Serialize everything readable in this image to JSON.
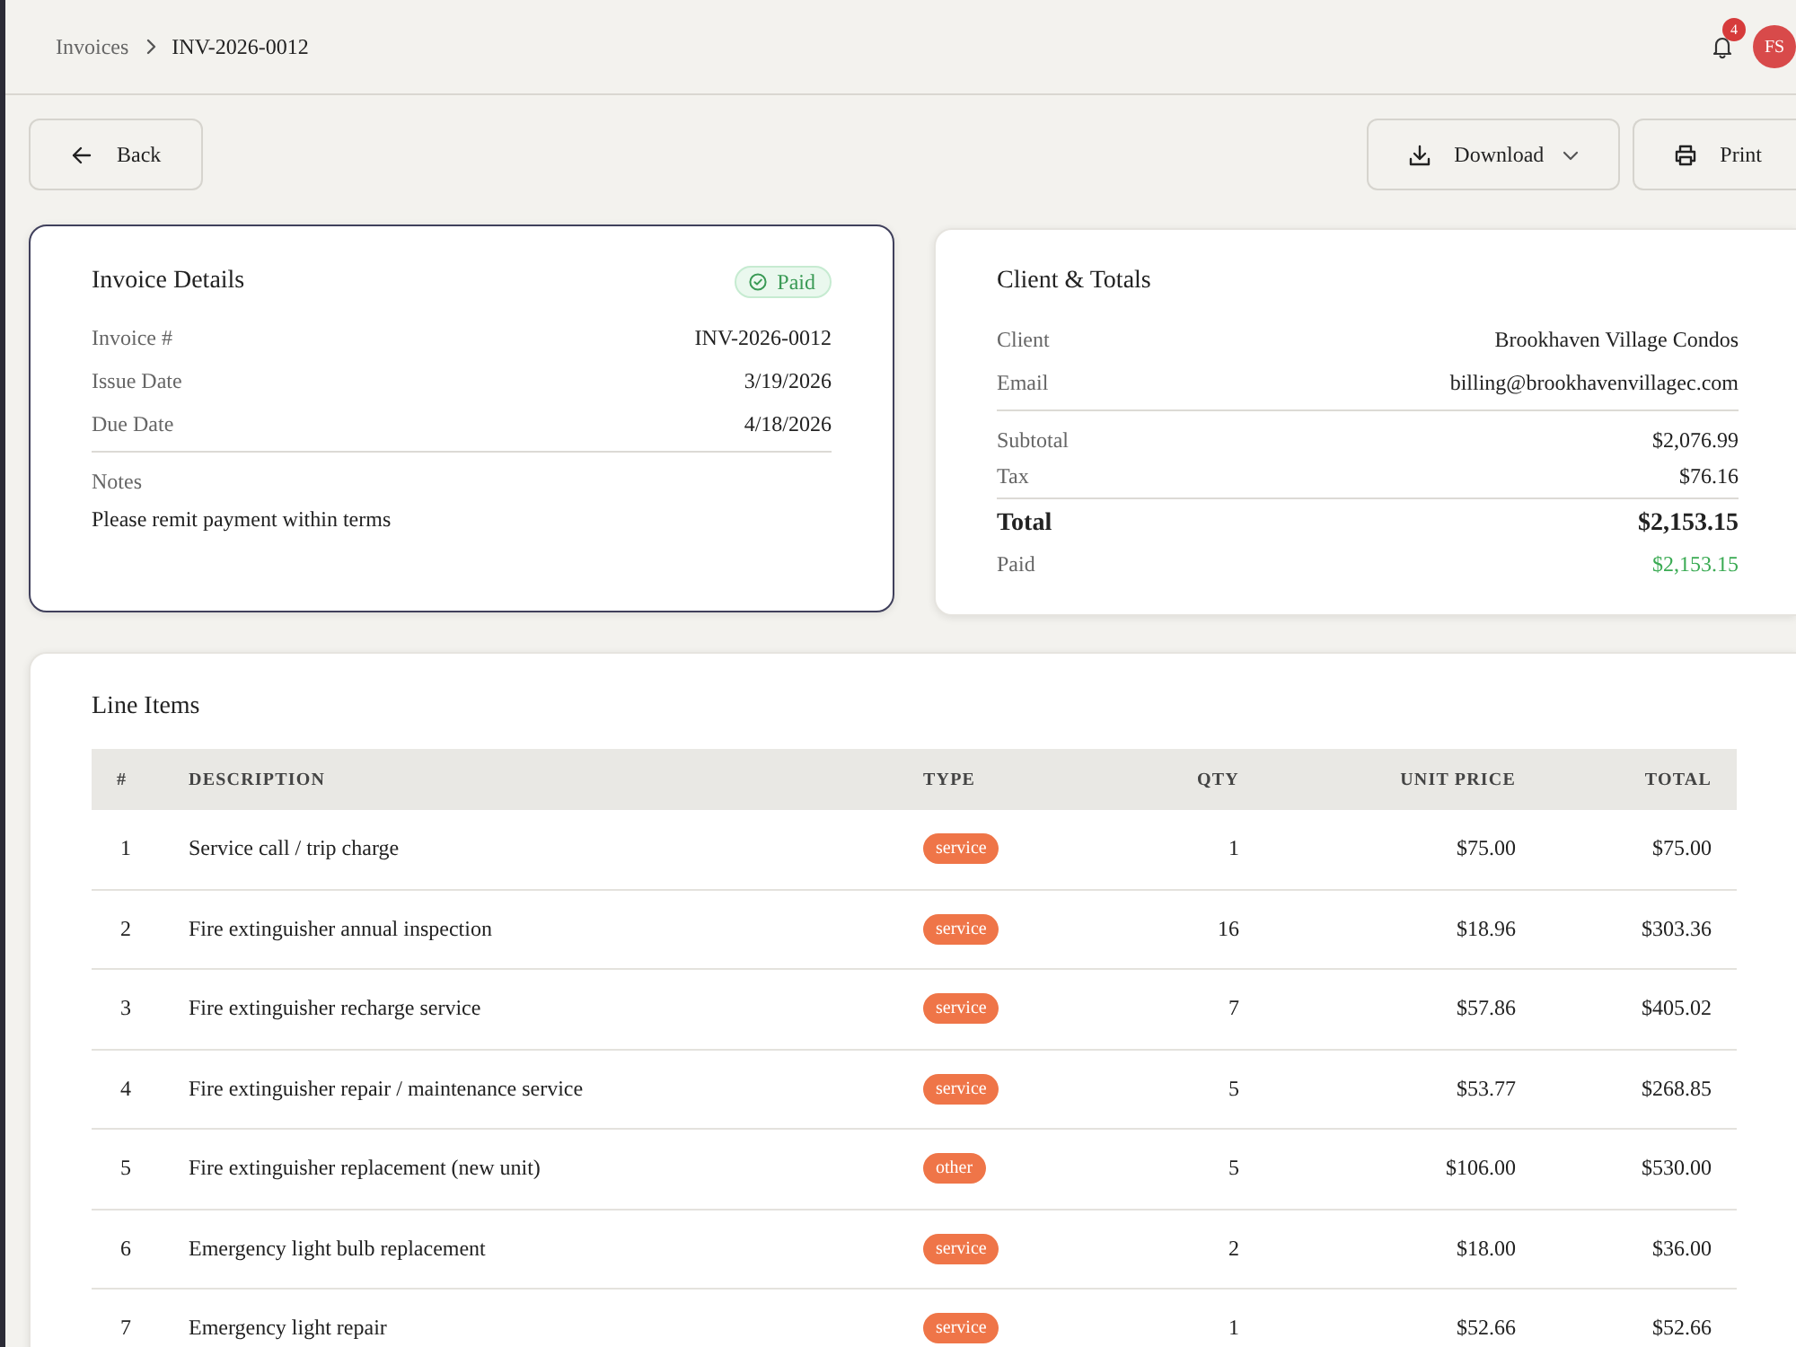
{
  "breadcrumb": [
    {
      "label": "Invoices",
      "current": false
    },
    {
      "label": "INV-2026-0012",
      "current": true
    }
  ],
  "header": {
    "notification_count": "4",
    "avatar_initials": "FS"
  },
  "toolbar": {
    "back": "Back",
    "download": "Download",
    "print": "Print"
  },
  "invoice_details": {
    "title": "Invoice Details",
    "status": {
      "label": "Paid",
      "kind": "paid"
    },
    "fields": [
      {
        "label": "Invoice #",
        "value": "INV-2026-0012"
      },
      {
        "label": "Issue Date",
        "value": "3/19/2026"
      },
      {
        "label": "Due Date",
        "value": "4/18/2026"
      }
    ],
    "notes_label": "Notes",
    "notes": "Please remit payment within terms"
  },
  "client_totals": {
    "title": "Client & Totals",
    "client_fields": [
      {
        "label": "Client",
        "value": "Brookhaven Village Condos"
      },
      {
        "label": "Email",
        "value": "billing@brookhavenvillagec.com"
      }
    ],
    "amounts": [
      {
        "label": "Subtotal",
        "value": "$2,076.99"
      },
      {
        "label": "Tax",
        "value": "$76.16"
      }
    ],
    "total": {
      "label": "Total",
      "value": "$2,153.15"
    },
    "paid": {
      "label": "Paid",
      "value": "$2,153.15"
    }
  },
  "line_items": {
    "title": "Line Items",
    "columns": [
      "#",
      "DESCRIPTION",
      "TYPE",
      "QTY",
      "UNIT PRICE",
      "TOTAL"
    ],
    "rows": [
      {
        "number": "1",
        "description": "Service call / trip charge",
        "type": "service",
        "qty": "1",
        "unit_price": "$75.00",
        "total": "$75.00"
      },
      {
        "number": "2",
        "description": "Fire extinguisher annual inspection",
        "type": "service",
        "qty": "16",
        "unit_price": "$18.96",
        "total": "$303.36"
      },
      {
        "number": "3",
        "description": "Fire extinguisher recharge service",
        "type": "service",
        "qty": "7",
        "unit_price": "$57.86",
        "total": "$405.02"
      },
      {
        "number": "4",
        "description": "Fire extinguisher repair / maintenance service",
        "type": "service",
        "qty": "5",
        "unit_price": "$53.77",
        "total": "$268.85"
      },
      {
        "number": "5",
        "description": "Fire extinguisher replacement (new unit)",
        "type": "other",
        "qty": "5",
        "unit_price": "$106.00",
        "total": "$530.00"
      },
      {
        "number": "6",
        "description": "Emergency light bulb replacement",
        "type": "service",
        "qty": "2",
        "unit_price": "$18.00",
        "total": "$36.00"
      },
      {
        "number": "7",
        "description": "Emergency light repair",
        "type": "service",
        "qty": "1",
        "unit_price": "$52.66",
        "total": "$52.66"
      }
    ]
  }
}
